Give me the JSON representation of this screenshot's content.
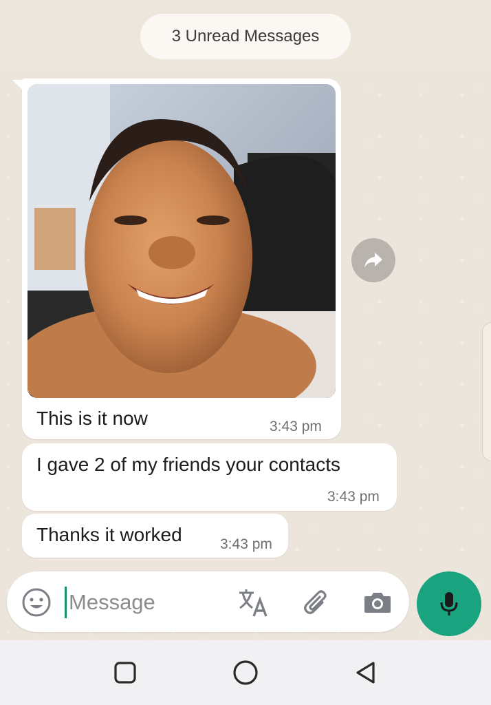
{
  "banner": {
    "unread_label": "3 Unread Messages"
  },
  "messages": [
    {
      "text": "This is it now",
      "time": "3:43 pm",
      "has_photo": true
    },
    {
      "text": "I gave 2 of my friends your contacts",
      "time": "3:43 pm"
    },
    {
      "text": "Thanks it worked",
      "time": "3:43 pm"
    }
  ],
  "composer": {
    "placeholder": "Message"
  },
  "icons": {
    "forward": "forward-arrow-icon",
    "emoji": "emoji-icon",
    "translate": "translate-icon",
    "attach": "paperclip-icon",
    "camera": "camera-icon",
    "mic": "microphone-icon",
    "nav_recent": "square-icon",
    "nav_home": "circle-icon",
    "nav_back": "triangle-back-icon"
  },
  "colors": {
    "accent": "#1aa37f",
    "chat_background": "#ece5dc",
    "bubble": "#ffffff"
  }
}
